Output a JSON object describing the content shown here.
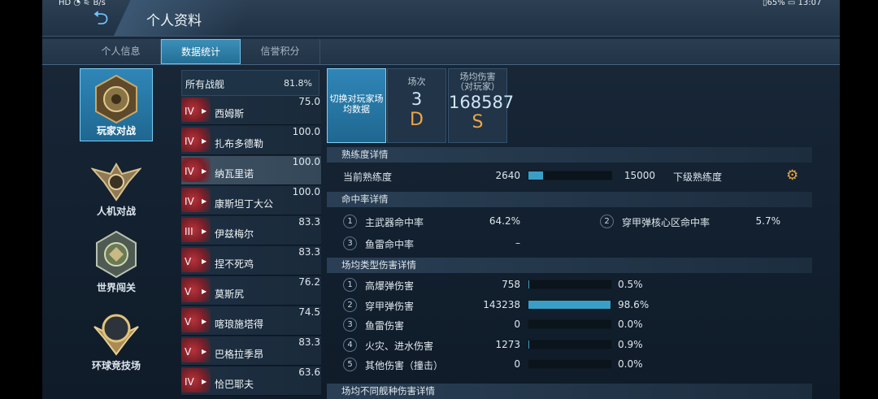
{
  "status_bar": {
    "left_text": "HD ◔ ⚟ B/s",
    "right_text": "▯65% ▭ 13:07"
  },
  "header": {
    "title": "个人资料"
  },
  "tabs": [
    {
      "label": "个人信息",
      "active": false
    },
    {
      "label": "数据统计",
      "active": true
    },
    {
      "label": "信誉积分",
      "active": false
    }
  ],
  "modes": [
    {
      "label": "玩家对战",
      "active": true
    },
    {
      "label": "人机对战",
      "active": false
    },
    {
      "label": "世界闯关",
      "active": false
    },
    {
      "label": "环球竞技场",
      "active": false
    }
  ],
  "ship_list": {
    "header_name": "所有战舰",
    "header_pct": "81.8%",
    "ships": [
      {
        "tier": "IV",
        "name": "西姆斯",
        "pct": "75.0",
        "selected": false
      },
      {
        "tier": "IV",
        "name": "扎布多德勒",
        "pct": "100.0",
        "selected": false
      },
      {
        "tier": "IV",
        "name": "纳瓦里诺",
        "pct": "100.0",
        "selected": true
      },
      {
        "tier": "IV",
        "name": "康斯坦丁大公",
        "pct": "100.0",
        "selected": false
      },
      {
        "tier": "III",
        "name": "伊兹梅尔",
        "pct": "83.3",
        "selected": false
      },
      {
        "tier": "V",
        "name": "捏不死鸡",
        "pct": "83.3",
        "selected": false
      },
      {
        "tier": "V",
        "name": "莫斯尻",
        "pct": "76.2",
        "selected": false
      },
      {
        "tier": "V",
        "name": "喀琅施塔得",
        "pct": "74.5",
        "selected": false
      },
      {
        "tier": "V",
        "name": "巴格拉季昂",
        "pct": "83.3",
        "selected": false
      },
      {
        "tier": "IV",
        "name": "恰巴耶夫",
        "pct": "63.6",
        "selected": false
      }
    ]
  },
  "cards": {
    "switch_label": "切换对玩家场均数据",
    "games_label": "场次",
    "games_value": "3",
    "games_grade": "D",
    "dmg_label_1": "场均伤害",
    "dmg_label_2": "（对玩家）",
    "dmg_value": "168587",
    "dmg_grade": "S"
  },
  "proficiency": {
    "title": "熟练度详情",
    "current_label": "当前熟练度",
    "current_value": "2640",
    "next_value": "15000",
    "next_label": "下级熟练度",
    "progress": 0.176
  },
  "accuracy": {
    "title": "命中率详情",
    "items": [
      {
        "n": "1",
        "label": "主武器命中率",
        "value": "64.2%"
      },
      {
        "n": "2",
        "label": "穿甲弹核心区命中率",
        "value": "5.7%"
      },
      {
        "n": "3",
        "label": "鱼雷命中率",
        "value": "–"
      }
    ]
  },
  "damage_types": {
    "title": "场均类型伤害详情",
    "rows": [
      {
        "n": "1",
        "label": "高爆弹伤害",
        "value": "758",
        "pct": "0.5%",
        "fraction": 0.005
      },
      {
        "n": "2",
        "label": "穿甲弹伤害",
        "value": "143238",
        "pct": "98.6%",
        "fraction": 0.986
      },
      {
        "n": "3",
        "label": "鱼雷伤害",
        "value": "0",
        "pct": "0.0%",
        "fraction": 0.0
      },
      {
        "n": "4",
        "label": "火灾、进水伤害",
        "value": "1273",
        "pct": "0.9%",
        "fraction": 0.009
      },
      {
        "n": "5",
        "label": "其他伤害（撞击）",
        "value": "0",
        "pct": "0.0%",
        "fraction": 0.0
      }
    ]
  },
  "ship_type_damage": {
    "title": "场均不同舰种伤害详情"
  },
  "colors": {
    "accent": "#3a9fc6",
    "grade": "#f0a546",
    "panel": "#223447"
  }
}
